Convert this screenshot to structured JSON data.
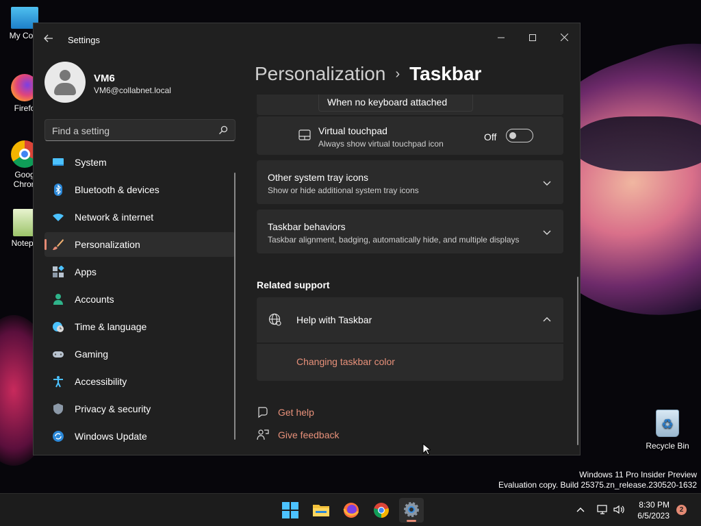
{
  "desktop": {
    "icons": [
      {
        "label": "My Com",
        "icon": "computer-icon"
      },
      {
        "label": "Firefo",
        "icon": "firefox-icon"
      },
      {
        "label": "Goog Chron",
        "icon": "chrome-icon"
      },
      {
        "label": "Notepa",
        "icon": "notepad-icon"
      }
    ],
    "recycle_bin": "Recycle Bin",
    "watermark_line1": "Windows 11 Pro Insider Preview",
    "watermark_line2": "Evaluation copy. Build 25375.zn_release.230520-1632"
  },
  "window": {
    "title": "Settings",
    "min_icon": "minimize-icon",
    "max_icon": "maximize-icon",
    "close_icon": "close-icon"
  },
  "profile": {
    "name": "VM6",
    "email": "VM6@collabnet.local"
  },
  "search": {
    "placeholder": "Find a setting",
    "value": ""
  },
  "nav": {
    "items": [
      {
        "label": "System",
        "icon": "system-icon"
      },
      {
        "label": "Bluetooth & devices",
        "icon": "bluetooth-icon"
      },
      {
        "label": "Network & internet",
        "icon": "wifi-icon"
      },
      {
        "label": "Personalization",
        "icon": "brush-icon",
        "active": true
      },
      {
        "label": "Apps",
        "icon": "apps-icon"
      },
      {
        "label": "Accounts",
        "icon": "person-icon"
      },
      {
        "label": "Time & language",
        "icon": "globe-clock-icon"
      },
      {
        "label": "Gaming",
        "icon": "gamepad-icon"
      },
      {
        "label": "Accessibility",
        "icon": "accessibility-icon"
      },
      {
        "label": "Privacy & security",
        "icon": "shield-icon"
      },
      {
        "label": "Windows Update",
        "icon": "update-icon"
      }
    ]
  },
  "breadcrumb": {
    "parent": "Personalization",
    "separator": "›",
    "current": "Taskbar"
  },
  "content": {
    "keyboard_dropdown": "When no keyboard attached",
    "touchpad": {
      "title": "Virtual touchpad",
      "subtitle": "Always show virtual touchpad icon",
      "state": "Off"
    },
    "other_tray": {
      "title": "Other system tray icons",
      "subtitle": "Show or hide additional system tray icons"
    },
    "behaviors": {
      "title": "Taskbar behaviors",
      "subtitle": "Taskbar alignment, badging, automatically hide, and multiple displays"
    },
    "related_support": "Related support",
    "help": {
      "title": "Help with Taskbar",
      "link": "Changing taskbar color"
    },
    "get_help": "Get help",
    "give_feedback": "Give feedback"
  },
  "taskbar": {
    "apps": [
      "start-icon",
      "file-explorer-icon",
      "firefox-icon",
      "chrome-icon",
      "settings-icon"
    ],
    "time": "8:30 PM",
    "date": "6/5/2023",
    "notifications": "2"
  },
  "colors": {
    "accent": "#e48a74",
    "window_bg": "#202020",
    "card_bg": "#2b2b2b"
  }
}
